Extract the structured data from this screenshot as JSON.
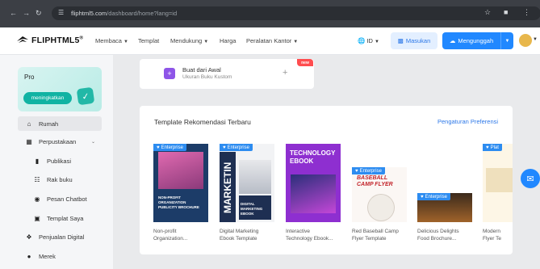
{
  "browser": {
    "url_host": "fliphtml5.com",
    "url_path": "/dashboard/home?lang=id"
  },
  "header": {
    "logo_text": "FLIPHTML5",
    "logo_reg": "®",
    "nav": [
      {
        "label": "Membaca",
        "has_caret": true
      },
      {
        "label": "Templat",
        "has_caret": false
      },
      {
        "label": "Mendukung",
        "has_caret": true
      },
      {
        "label": "Harga",
        "has_caret": false
      },
      {
        "label": "Peralatan Kantor",
        "has_caret": true
      }
    ],
    "language": "ID",
    "login_label": "Masukan",
    "upload_label": "Mengunggah"
  },
  "sidebar": {
    "plan": "Pro",
    "upgrade_label": "meningkatkan",
    "items": [
      {
        "label": "Rumah",
        "icon": "home-icon"
      },
      {
        "label": "Perpustakaan",
        "icon": "grid-icon"
      },
      {
        "label": "Publikasi",
        "icon": "book-icon"
      },
      {
        "label": "Rak buku",
        "icon": "bookshelf-icon"
      },
      {
        "label": "Pesan Chatbot",
        "icon": "chat-icon"
      },
      {
        "label": "Templat Saya",
        "icon": "folder-icon"
      },
      {
        "label": "Penjualan Digital",
        "icon": "tag-icon"
      },
      {
        "label": "Merek",
        "icon": "brand-icon"
      }
    ]
  },
  "create": {
    "title": "Buat dari Awal",
    "subtitle": "Ukuran Buku Kustom",
    "badge": "new"
  },
  "templates": {
    "section_title": "Template Rekomendasi Terbaru",
    "settings_link": "Pengaturan Preferensi",
    "badge_label": "Enterprise",
    "badge_label_short": "Plat",
    "items": [
      {
        "caption1": "Non-profit",
        "caption2": "Organization...",
        "cover_text": "NON-PROFIT ORGANIZATION PUBLICITY BROCHURE"
      },
      {
        "caption1": "Digital Marketing",
        "caption2": "Ebook Template",
        "cover_text": "MARKETIN",
        "cover_sub": "DIGITAL MARKETING EBOOK"
      },
      {
        "caption1": "Interactive",
        "caption2": "Technology Ebook...",
        "cover_text": "TECHNOLOGY EBOOK"
      },
      {
        "caption1": "Red Baseball Camp",
        "caption2": "Flyer Template",
        "cover_text": "BASEBALL CAMP FLYER"
      },
      {
        "caption1": "Delicious Delights",
        "caption2": "Food Brochure..."
      },
      {
        "caption1": "Modern",
        "caption2": "Flyer Te"
      }
    ]
  },
  "colors": {
    "primary": "#2188ff",
    "teal": "#10b3a3",
    "enterprise": "#2d8cf0",
    "new_badge": "#ff4d4f"
  }
}
